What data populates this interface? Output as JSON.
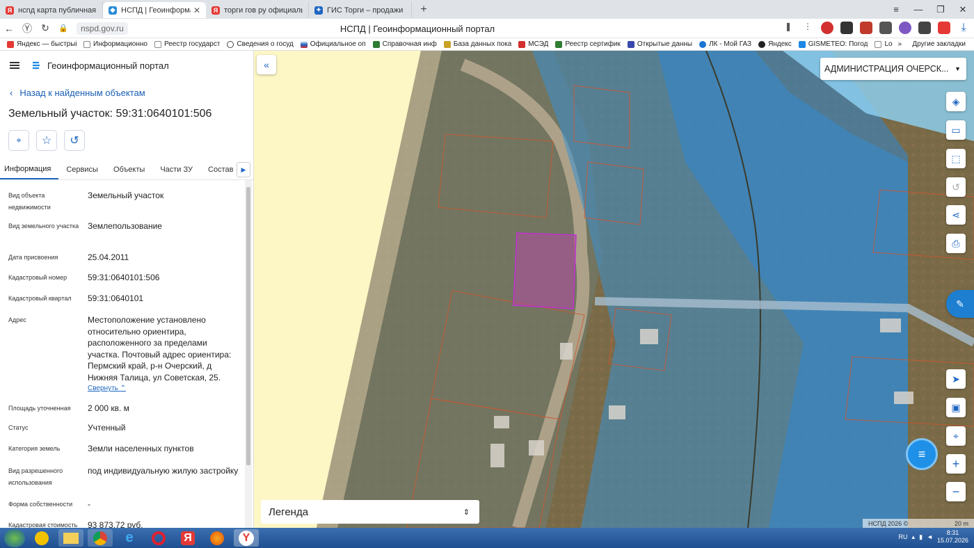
{
  "browser": {
    "tabs": [
      {
        "label": "нсnд карта публичная кад",
        "fav": "Я",
        "color": "#e53935"
      },
      {
        "label": "НСПД | Геоинформацион",
        "fav": "◆",
        "color": "#2a8bd6"
      },
      {
        "label": "торги гов ру официальны",
        "fav": "Я",
        "color": "#e53935"
      },
      {
        "label": "ГИС Торги – продажи гос",
        "fav": "✦",
        "color": "#1f66c2"
      }
    ],
    "url": "nspd.gov.ru",
    "page_title": "НСПД | Геоинформационный портал",
    "bookmarks": [
      "Яндекс — быстрый",
      "Информационно",
      "Реестр государст",
      "Сведения о госуд",
      "Официальное оп",
      "Справочная инф",
      "База данных пока",
      "МСЭД",
      "Реестр сертифик",
      "Открытые данны",
      "ЛК - Мой ГАЗ",
      "Яндекс",
      "GISMETEO: Погод",
      "Lo"
    ],
    "other_bookmarks": "Другие закладки",
    "more_bookmarks": "»"
  },
  "panel": {
    "portal_title": "Геоинформационный портал",
    "back_label": "Назад к найденным объектам",
    "object_title": "Земельный участок: 59:31:0640101:506",
    "tabs": [
      "Информация",
      "Сервисы",
      "Объекты",
      "Части ЗУ",
      "Состав"
    ],
    "fields": [
      {
        "key": "Вид объекта недвижимости",
        "value": "Земельный участок"
      },
      {
        "key": "Вид земельного участка",
        "value": "Землепользование"
      },
      {
        "key": "Дата присвоения",
        "value": "25.04.2011"
      },
      {
        "key": "Кадастровый номер",
        "value": "59:31:0640101:506"
      },
      {
        "key": "Кадастровый квартал",
        "value": "59:31:0640101"
      },
      {
        "key": "Адрес",
        "value": "Местоположение установлено относительно ориентира, расположенного за пределами участка. Почтовый адрес ориентира: Пермский край, р-н Очерский, д Нижняя Талица, ул Советская, 25."
      },
      {
        "key": "Площадь уточненная",
        "value": "2 000 кв. м"
      },
      {
        "key": "Статус",
        "value": "Учтенный"
      },
      {
        "key": "Категория земель",
        "value": "Земли населенных пунктов"
      },
      {
        "key": "Вид разрешенного использования",
        "value": "под индивидуальную жилую застройку"
      },
      {
        "key": "Форма собственности",
        "value": "-"
      },
      {
        "key": "Кадастровая стоимость",
        "value": "93 873,72 руб."
      }
    ],
    "collapse_label": "Свернуть"
  },
  "map": {
    "admin_select": "АДМИНИСТРАЦИЯ ОЧЕРСК...",
    "legend_label": "Легенда",
    "copyright": "НСПД 2026 ©",
    "scale": "20 m"
  },
  "taskbar": {
    "lang": "RU",
    "time": "8:31",
    "date": "15.07.2026"
  }
}
